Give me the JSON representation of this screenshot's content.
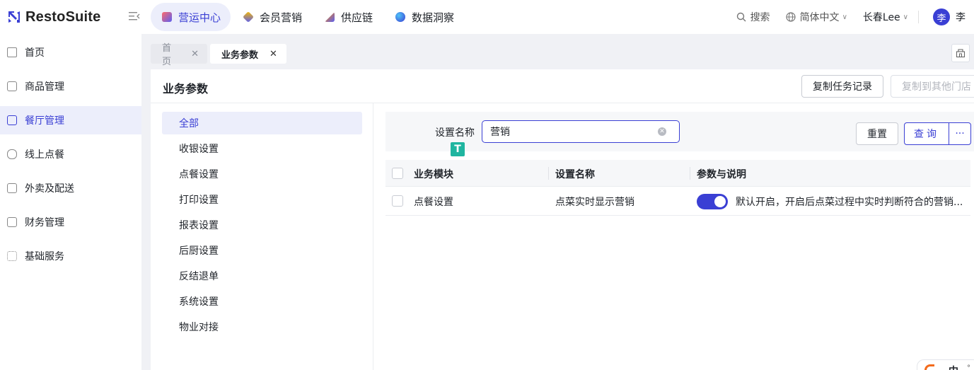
{
  "app": {
    "name": "RestoSuite",
    "brand_color": "#3a3fd4"
  },
  "topnav": [
    {
      "label": "营运中心",
      "icon": "cube-icon",
      "active": true
    },
    {
      "label": "会员营销",
      "icon": "diamond-icon"
    },
    {
      "label": "供应链",
      "icon": "flag-icon"
    },
    {
      "label": "数据洞察",
      "icon": "globe-icon"
    }
  ],
  "top_right": {
    "search_label": "搜索",
    "language_label": "简体中文",
    "store_label": "长春Lee",
    "avatar_initial": "李",
    "user_name": "李"
  },
  "sidebar": [
    {
      "label": "首页",
      "icon": "home-icon"
    },
    {
      "label": "商品管理",
      "icon": "box-icon"
    },
    {
      "label": "餐厅管理",
      "icon": "store-icon",
      "active": true
    },
    {
      "label": "线上点餐",
      "icon": "hand-icon"
    },
    {
      "label": "外卖及配送",
      "icon": "bag-icon"
    },
    {
      "label": "财务管理",
      "icon": "folder-icon"
    },
    {
      "label": "基础服务",
      "icon": "grid-icon"
    }
  ],
  "tabs": [
    {
      "label": "首页",
      "close": "✕"
    },
    {
      "label": "业务参数",
      "close": "✕",
      "active": true
    }
  ],
  "page": {
    "title": "业务参数",
    "copy_task_button": "复制任务记录",
    "copy_to_stores_button": "复制到其他门店"
  },
  "categories": [
    "全部",
    "收银设置",
    "点餐设置",
    "打印设置",
    "报表设置",
    "后厨设置",
    "反结退单",
    "系统设置",
    "物业对接"
  ],
  "filter": {
    "label": "设置名称",
    "value": "营销",
    "badge": "T",
    "reset_button": "重置",
    "query_button": "查询",
    "more_button": "···"
  },
  "table": {
    "headers": [
      "业务模块",
      "设置名称",
      "参数与说明"
    ],
    "rows": [
      {
        "module": "点餐设置",
        "name": "点菜实时显示营销",
        "enabled": true,
        "description": "默认开启，开启后点菜过程中实时判断符合的营销..."
      }
    ]
  },
  "corner_widget": {
    "label": "中"
  }
}
